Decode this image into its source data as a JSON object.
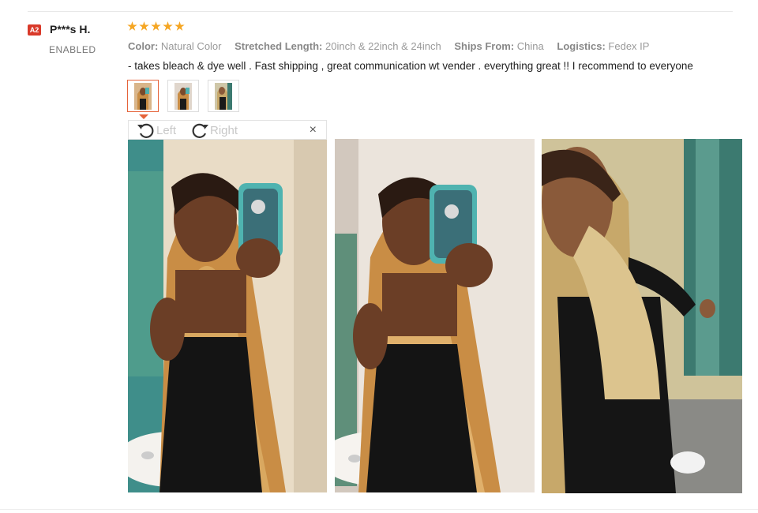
{
  "review": {
    "country_code": "A2",
    "user_name": "P***s H.",
    "user_status": "ENABLED",
    "rating": 5,
    "properties": [
      {
        "label": "Color:",
        "value": "Natural Color"
      },
      {
        "label": "Stretched Length:",
        "value": "20inch & 22inch & 24inch"
      },
      {
        "label": "Ships From:",
        "value": "China"
      },
      {
        "label": "Logistics:",
        "value": "Fedex IP"
      }
    ],
    "text": "- takes bleach & dye well . Fast shipping , great communication wt vender . everything great !! I recommend to everyone"
  },
  "viewer": {
    "rotate_left_label": "Left",
    "rotate_right_label": "Right",
    "close_label": "×"
  },
  "colors": {
    "star": "#f5a623",
    "flag": "#d93a2a",
    "active_border": "#e5633a"
  },
  "photos": [
    "review-photo-1",
    "review-photo-2",
    "review-photo-3"
  ]
}
